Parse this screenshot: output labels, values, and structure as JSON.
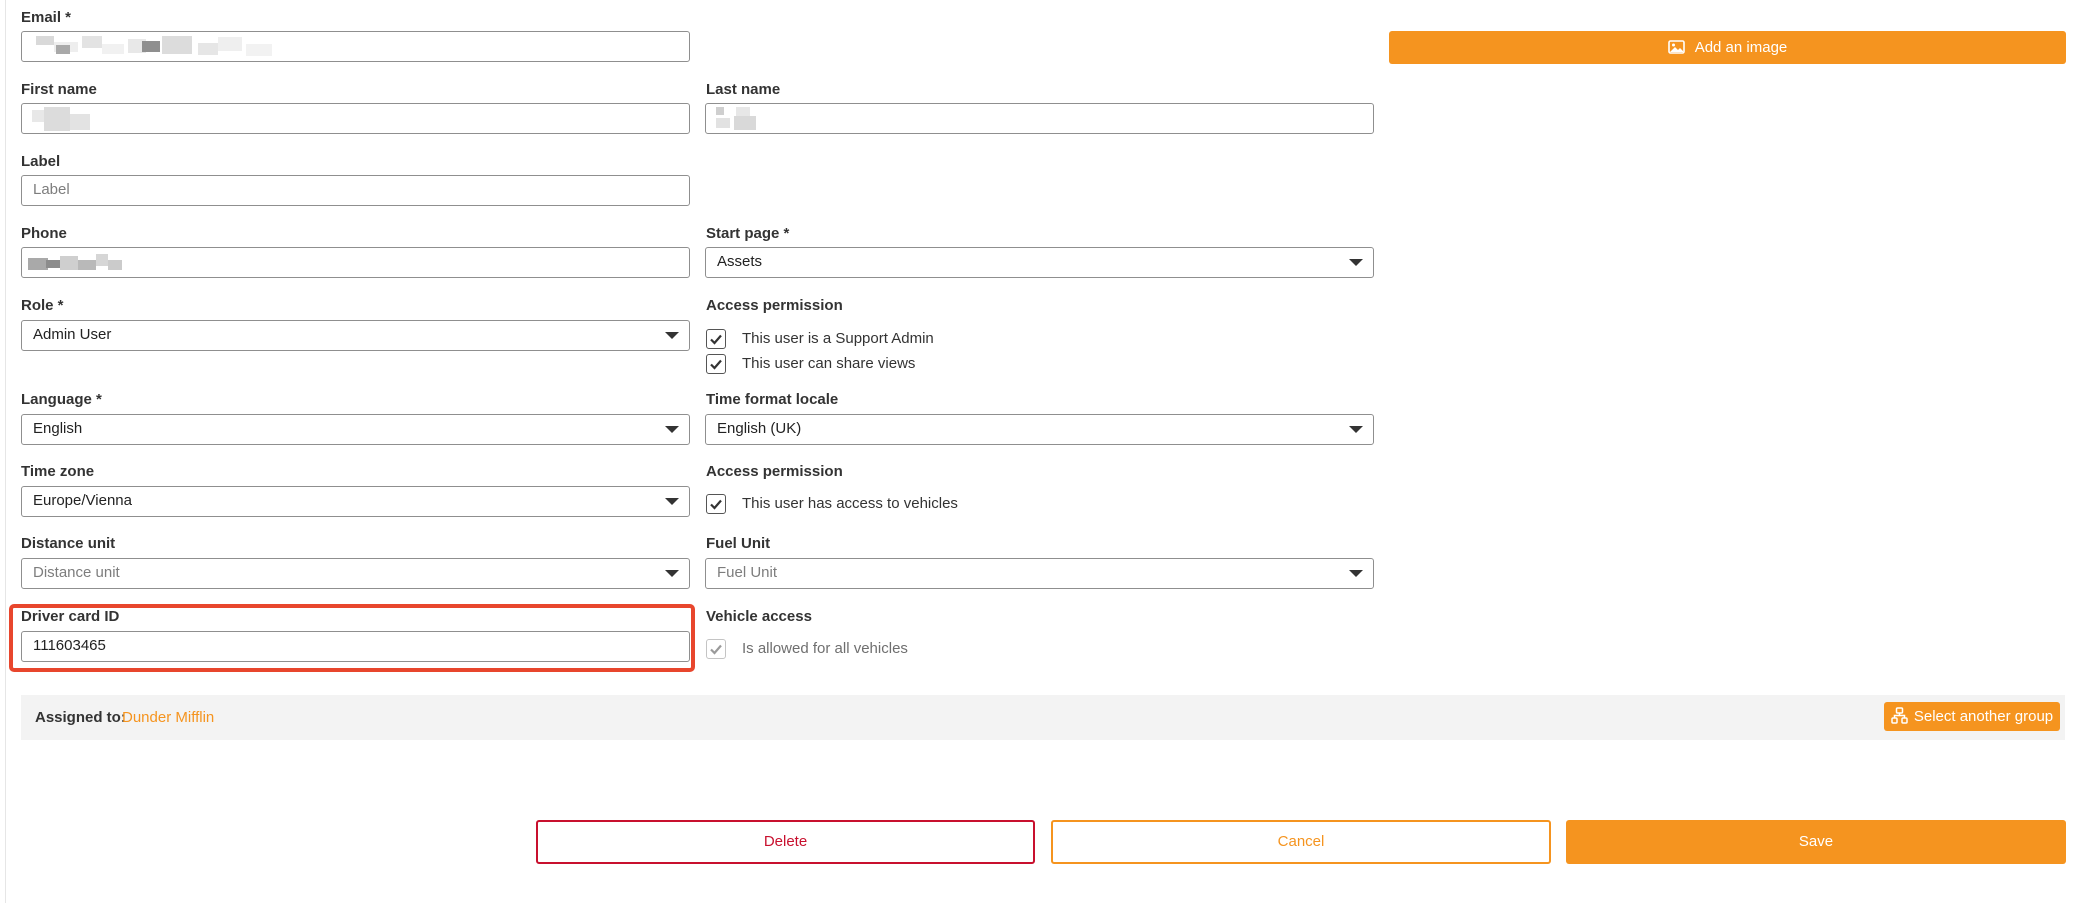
{
  "form": {
    "email": {
      "label": "Email *"
    },
    "first_name": {
      "label": "First name"
    },
    "last_name": {
      "label": "Last name"
    },
    "label_field": {
      "label": "Label",
      "placeholder": "Label"
    },
    "phone": {
      "label": "Phone"
    },
    "start_page": {
      "label": "Start page *",
      "value": "Assets"
    },
    "role": {
      "label": "Role *",
      "value": "Admin User"
    },
    "access_permission_1": {
      "label": "Access permission",
      "options": [
        {
          "text": "This user is a Support Admin",
          "checked": true
        },
        {
          "text": "This user can share views",
          "checked": true
        }
      ]
    },
    "language": {
      "label": "Language *",
      "value": "English"
    },
    "time_format_locale": {
      "label": "Time format locale",
      "value": "English (UK)"
    },
    "time_zone": {
      "label": "Time zone",
      "value": "Europe/Vienna"
    },
    "access_permission_2": {
      "label": "Access permission",
      "options": [
        {
          "text": "This user has access to vehicles",
          "checked": true
        }
      ]
    },
    "distance_unit": {
      "label": "Distance unit",
      "placeholder": "Distance unit"
    },
    "fuel_unit": {
      "label": "Fuel Unit",
      "placeholder": "Fuel Unit"
    },
    "driver_card_id": {
      "label": "Driver card ID",
      "value": "111603465"
    },
    "vehicle_access": {
      "label": "Vehicle access",
      "option": {
        "text": "Is allowed for all vehicles",
        "checked": true,
        "disabled": true
      }
    }
  },
  "image_button": {
    "label": "Add an image",
    "icon": "image-icon"
  },
  "assignment": {
    "label": "Assigned to:",
    "group": "Dunder Mifflin",
    "select_label": "Select another group",
    "icon": "group-hierarchy-icon"
  },
  "actions": {
    "delete": "Delete",
    "cancel": "Cancel",
    "save": "Save"
  },
  "colors": {
    "accent": "#f5941f",
    "danger": "#c8102e",
    "highlight": "#e8462d"
  }
}
